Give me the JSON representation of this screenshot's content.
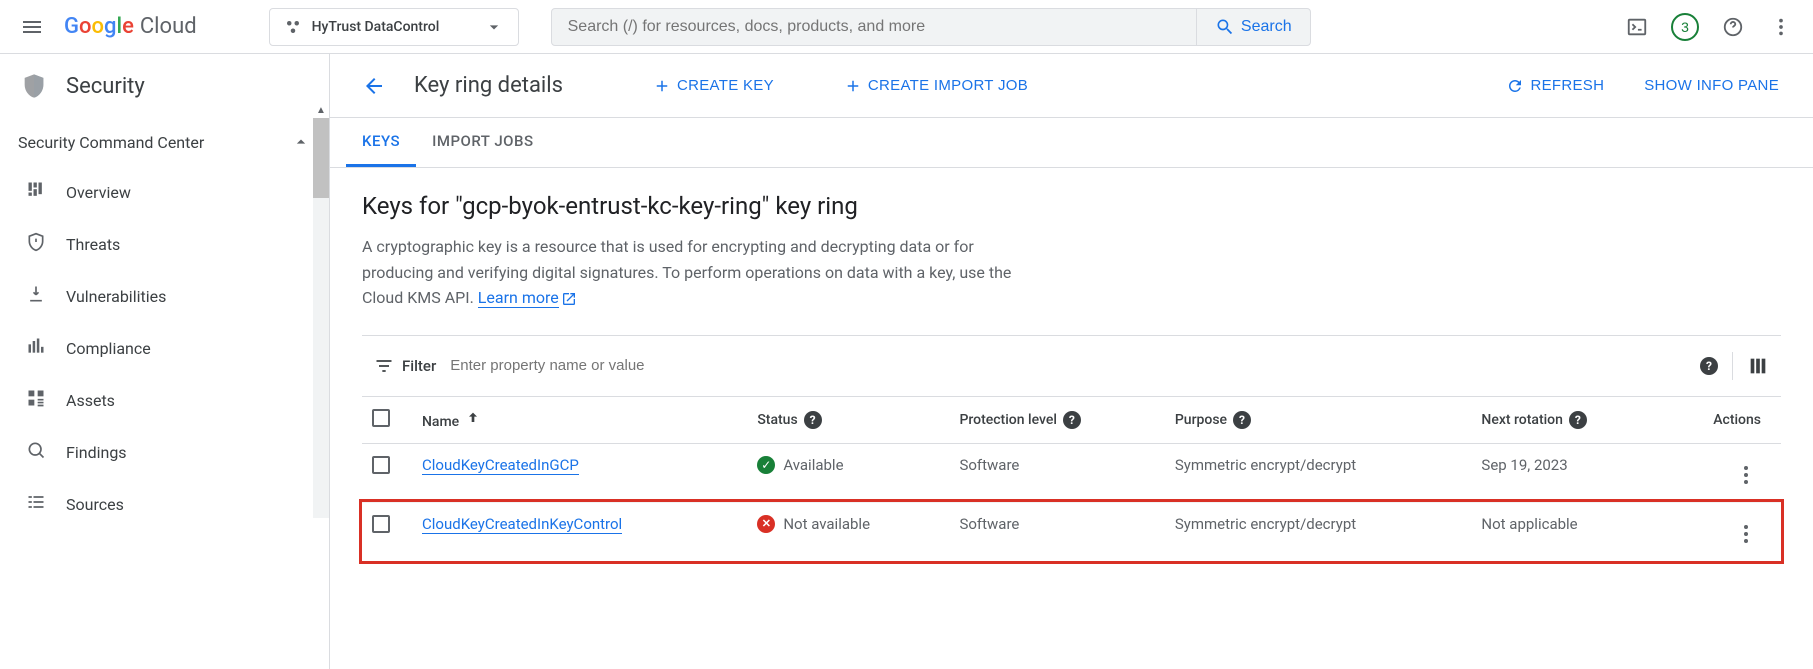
{
  "topbar": {
    "logo_cloud": "Cloud",
    "project_name": "HyTrust DataControl",
    "search_placeholder": "Search (/) for resources, docs, products, and more",
    "search_button": "Search",
    "notification_count": "3"
  },
  "sidebar": {
    "product_title": "Security",
    "section_title": "Security Command Center",
    "items": [
      {
        "label": "Overview",
        "icon": "dashboard"
      },
      {
        "label": "Threats",
        "icon": "shield-alert"
      },
      {
        "label": "Vulnerabilities",
        "icon": "download-warn"
      },
      {
        "label": "Compliance",
        "icon": "compliance"
      },
      {
        "label": "Assets",
        "icon": "assets"
      },
      {
        "label": "Findings",
        "icon": "findings"
      },
      {
        "label": "Sources",
        "icon": "list"
      }
    ]
  },
  "header": {
    "title": "Key ring details",
    "create_key": "CREATE KEY",
    "create_import_job": "CREATE IMPORT JOB",
    "refresh": "REFRESH",
    "show_info": "SHOW INFO PANE"
  },
  "tabs": [
    {
      "label": "KEYS",
      "active": true
    },
    {
      "label": "IMPORT JOBS",
      "active": false
    }
  ],
  "content": {
    "heading": "Keys for \"gcp-byok-entrust-kc-key-ring\" key ring",
    "description_part1": "A cryptographic key is a resource that is used for encrypting and decrypting data or for producing and verifying digital signatures. To perform operations on data with a key, use the Cloud KMS API. ",
    "learn_more": "Learn more"
  },
  "filter": {
    "label": "Filter",
    "placeholder": "Enter property name or value"
  },
  "table": {
    "columns": {
      "name": "Name",
      "status": "Status",
      "protection": "Protection level",
      "purpose": "Purpose",
      "rotation": "Next rotation",
      "actions": "Actions"
    },
    "rows": [
      {
        "name": "CloudKeyCreatedInGCP",
        "status_label": "Available",
        "status_ok": true,
        "protection": "Software",
        "purpose": "Symmetric encrypt/decrypt",
        "rotation": "Sep 19, 2023",
        "highlight": false
      },
      {
        "name": "CloudKeyCreatedInKeyControl",
        "status_label": "Not available",
        "status_ok": false,
        "protection": "Software",
        "purpose": "Symmetric encrypt/decrypt",
        "rotation": "Not applicable",
        "highlight": true
      }
    ]
  }
}
